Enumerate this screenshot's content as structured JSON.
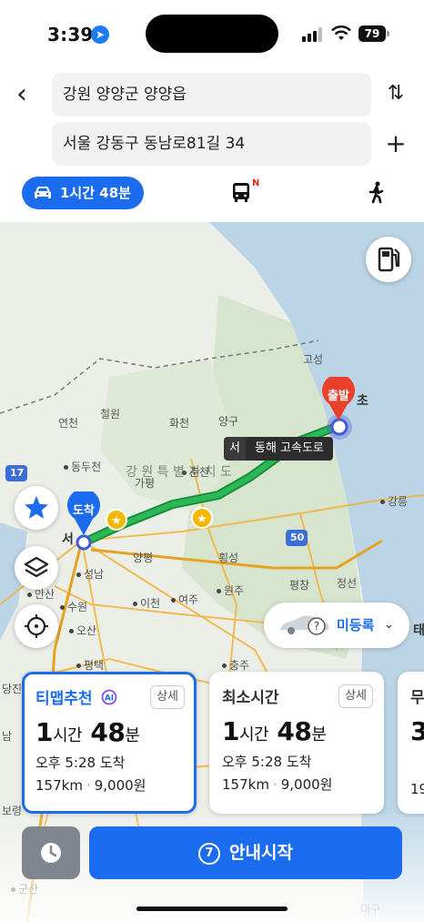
{
  "status_bar": {
    "time": "3:39",
    "battery": "79"
  },
  "search": {
    "origin": "강원 양양군 양양읍",
    "destination": "서울 강동구 동남로81길 34"
  },
  "modes": {
    "car_label": "1시간 48분",
    "bus_badge": "N"
  },
  "map": {
    "labels": {
      "goseong": "고성",
      "yeoncheon": "연천",
      "cheorwon": "철원",
      "hwacheon": "화천",
      "yanggu": "양구",
      "dongducheon": "동두천",
      "gangwon": "강 원 특 별 자 치 도",
      "gapyeong": "가평",
      "chuncheon": "춘천",
      "gangneung": "강릉",
      "yangpyeong": "양평",
      "hoengseong": "횡성",
      "seongnam": "성남",
      "pyeongchang": "평창",
      "jeongseon": "정선",
      "ansan": "안산",
      "suwon": "수원",
      "icheon": "이천",
      "yeoju": "여주",
      "wonju": "원주",
      "osan": "오산",
      "pyeongtaek": "평택",
      "chungju": "충주",
      "seo": "서",
      "cho": "초",
      "dangjin": "당진",
      "boryeong": "보령",
      "gunsan": "군산",
      "daegu": "대구",
      "tae": "태",
      "nam": "남",
      "highway_17": "17",
      "highway_50": "50"
    },
    "start_pin": "출발",
    "end_pin": "도착",
    "road_tooltip": "동해 고속도로",
    "road_tooltip_prefix": "서",
    "vehicle_label": "미등록"
  },
  "routes": [
    {
      "title": "티맵추천",
      "detail": "상세",
      "dur_h": "1",
      "dur_h_unit": "시간",
      "dur_m": "48",
      "dur_m_unit": "분",
      "arrival": "오후 5:28 도착",
      "distance": "157km",
      "fee": "9,000원"
    },
    {
      "title": "최소시간",
      "detail": "상세",
      "dur_h": "1",
      "dur_h_unit": "시간",
      "dur_m": "48",
      "dur_m_unit": "분",
      "arrival": "오후 5:28 도착",
      "distance": "157km",
      "fee": "9,000원"
    },
    {
      "title": "무",
      "dur_h": "3",
      "distance": "19"
    }
  ],
  "actions": {
    "start_number": "7",
    "start_label": "안내시작"
  },
  "colors": {
    "accent": "#1c6cf0",
    "route": "#1aa84a",
    "start_pin": "#e8402a"
  }
}
